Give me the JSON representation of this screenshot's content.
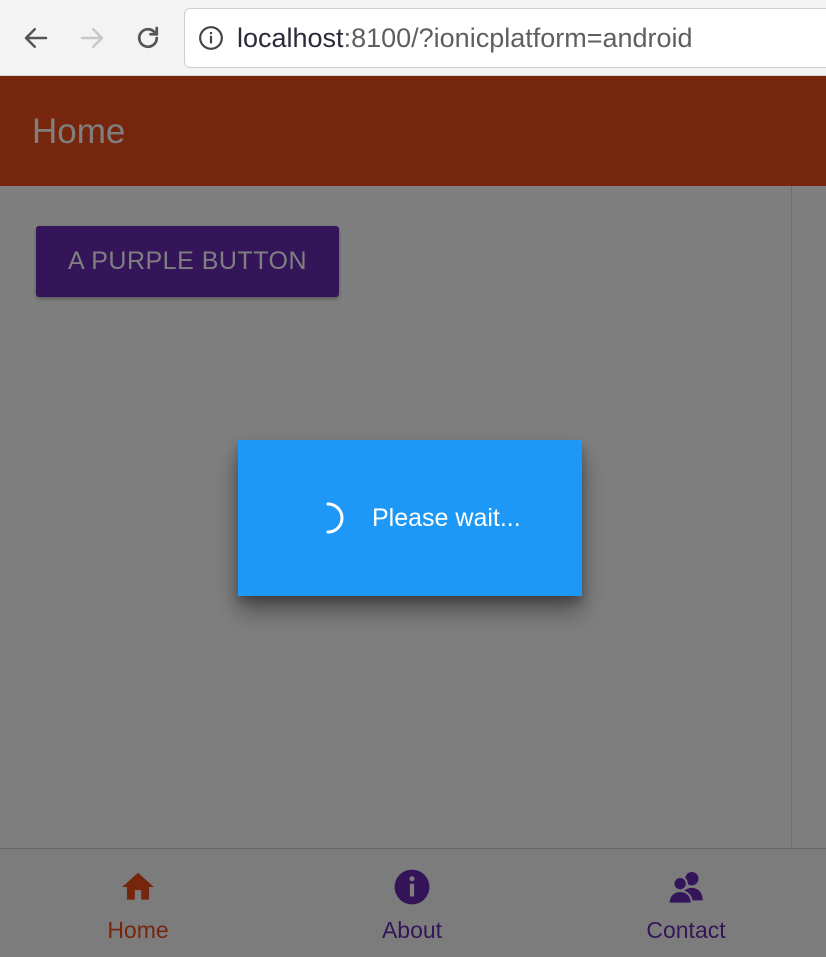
{
  "browser": {
    "url_host": "localhost",
    "url_rest": ":8100/?ionicplatform=android",
    "back_icon": "arrow-left-icon",
    "forward_icon": "arrow-right-icon",
    "reload_icon": "reload-icon",
    "info_icon": "info-icon"
  },
  "toolbar": {
    "title": "Home",
    "color": "#eb4c1a"
  },
  "content": {
    "button_label": "A PURPLE BUTTON",
    "button_color": "#6b2bb5"
  },
  "loading": {
    "message": "Please wait...",
    "color": "#1e98f6",
    "icon": "spinner-icon"
  },
  "tabs": [
    {
      "label": "Home",
      "icon": "home-icon",
      "selected": true,
      "color": "#eb4c1a"
    },
    {
      "label": "About",
      "icon": "information-circle-icon",
      "selected": false,
      "color": "#6b2bb5"
    },
    {
      "label": "Contact",
      "icon": "contacts-icon",
      "selected": false,
      "color": "#6b2bb5"
    }
  ]
}
